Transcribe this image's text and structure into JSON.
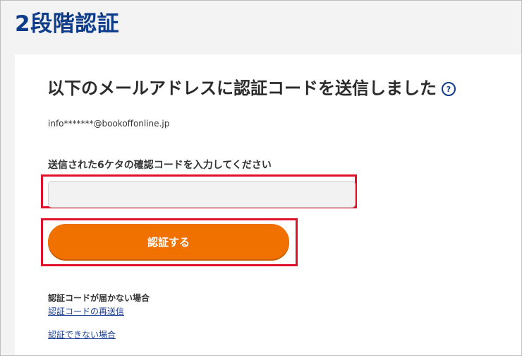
{
  "page": {
    "title": "2段階認証"
  },
  "card": {
    "heading": "以下のメールアドレスに認証コードを送信しました",
    "help_icon_glyph": "?",
    "email": "info*******@bookoffonline.jp",
    "code_label": "送信された6ケタの確認コードを入力してください",
    "code_input": {
      "value": "",
      "placeholder": ""
    },
    "verify_button_label": "認証する",
    "not_received_label": "認証コードが届かない場合",
    "resend_link": "認証コードの再送信",
    "cannot_verify_link": "認証できない場合"
  },
  "colors": {
    "title": "#0e3b8a",
    "button": "#f07000",
    "highlight": "#e0102a",
    "link": "#1b3f94"
  },
  "icons": {
    "help": "help-circle-icon"
  }
}
